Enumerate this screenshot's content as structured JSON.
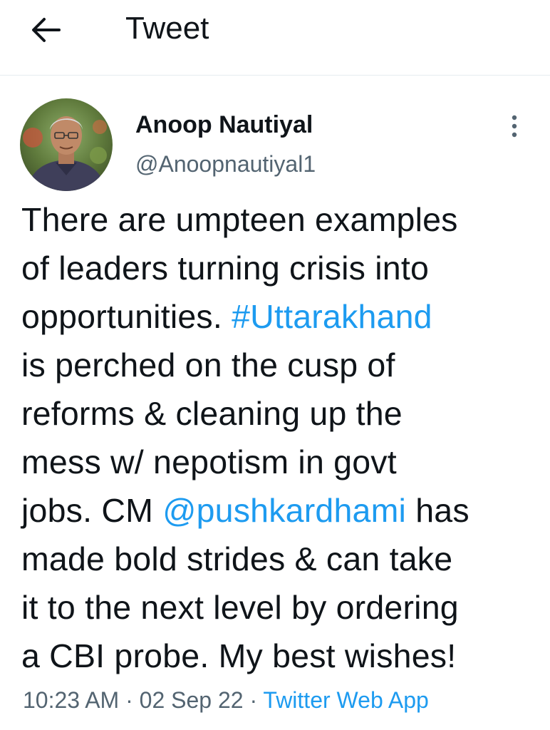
{
  "header": {
    "title": "Tweet",
    "back_icon": "arrow-left-icon"
  },
  "tweet": {
    "author_name": "Anoop Nautiyal",
    "author_handle": "@Anoopnautiyal1",
    "more_icon": "more-vertical-icon",
    "text_lines": {
      "l1": "There are umpteen examples",
      "l2": "of leaders turning crisis into",
      "l3_pre": "opportunities. ",
      "l3_hashtag": "#Uttarakhand",
      "l4": "is perched on the cusp of",
      "l5": "reforms & cleaning up the",
      "l6": "mess w/ nepotism in govt",
      "l7_pre": "jobs. CM ",
      "l7_mention": "@pushkardhami",
      "l7_post": " has",
      "l8": "made bold strides & can take",
      "l9": "it to the next level by ordering",
      "l10": "a CBI probe. My best wishes!"
    },
    "time": "10:23 AM",
    "date": "02 Sep 22",
    "separator": " · ",
    "source": "Twitter Web App"
  },
  "colors": {
    "link": "#1d9bf0",
    "secondary_text": "#536471",
    "primary_text": "#0f1419"
  }
}
